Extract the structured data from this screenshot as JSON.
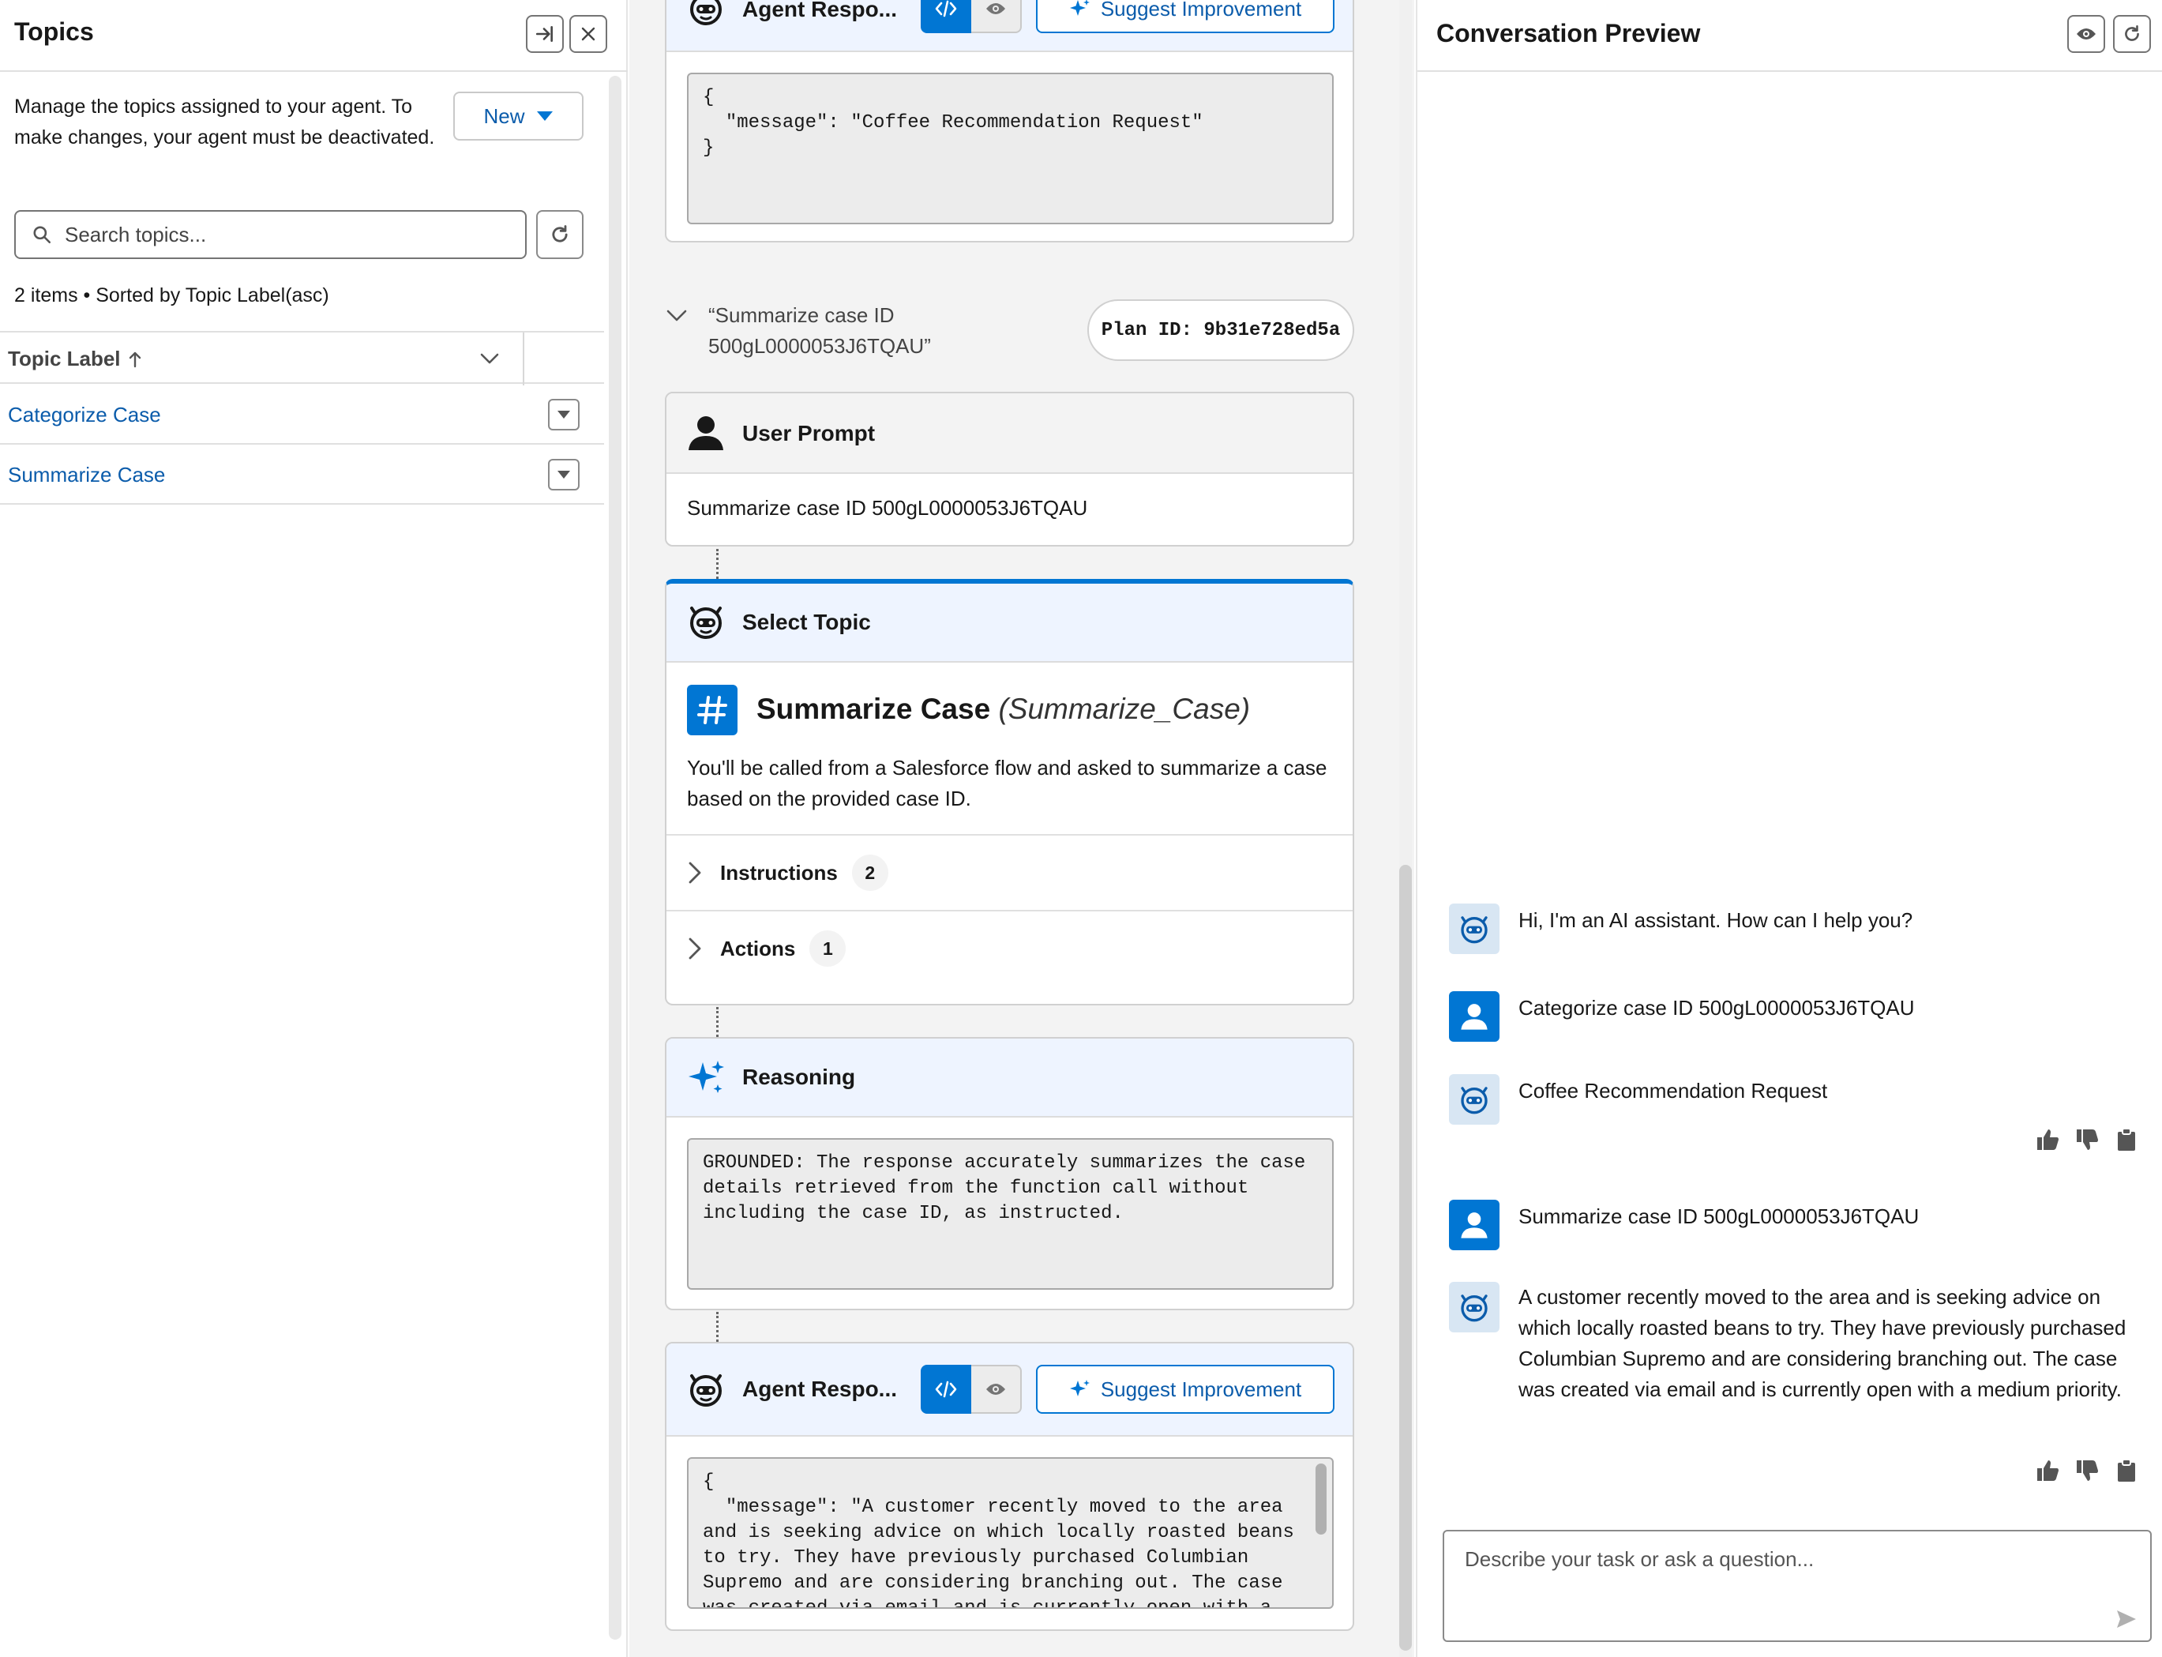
{
  "left": {
    "title": "Topics",
    "description": "Manage the topics assigned to your agent. To make changes, your agent must be deactivated.",
    "new_label": "New",
    "search_placeholder": "Search topics...",
    "items_info": "2 items • Sorted by Topic Label(asc)",
    "column_header": "Topic Label",
    "rows": [
      {
        "label": "Categorize Case"
      },
      {
        "label": "Summarize Case"
      }
    ]
  },
  "middle": {
    "top_agent_title": "Agent Respo...",
    "suggest_label": "Suggest Improvement",
    "top_response_code": "{\n  \"message\": \"Coffee Recommendation Request\"\n}",
    "plan_summary": "“Summarize case ID\n500gL0000053J6TQAU”",
    "plan_id": "Plan ID: 9b31e728ed5a",
    "user_prompt_title": "User Prompt",
    "user_prompt_text": "Summarize case ID 500gL0000053J6TQAU",
    "select_topic_title": "Select Topic",
    "topic_name": "Summarize Case",
    "topic_api": "(Summarize_Case)",
    "topic_desc": "You'll be called from a Salesforce flow and asked to summarize a case based on the provided case ID.",
    "instructions_label": "Instructions",
    "instructions_count": "2",
    "actions_label": "Actions",
    "actions_count": "1",
    "reasoning_title": "Reasoning",
    "reasoning_text": "GROUNDED: The response accurately summarizes the case details retrieved from the function call without including the case ID, as instructed.",
    "bottom_agent_title": "Agent Respo...",
    "bottom_response_code": "{\n  \"message\": \"A customer recently moved to the area and is seeking advice on which locally roasted beans to try. They have previously purchased Columbian Supremo and are considering branching out. The case was created via email and is currently open with a medium priority.\"\n}"
  },
  "right": {
    "title": "Conversation Preview",
    "messages": [
      {
        "role": "bot",
        "text": "Hi, I'm an AI assistant. How can I help you?"
      },
      {
        "role": "user",
        "text": "Categorize case ID 500gL0000053J6TQAU"
      },
      {
        "role": "bot",
        "text": "Coffee Recommendation Request"
      },
      {
        "role": "user",
        "text": "Summarize case ID 500gL0000053J6TQAU"
      },
      {
        "role": "bot",
        "text": "A customer recently moved to the area and is seeking advice on which locally roasted beans to try. They have previously purchased Columbian Supremo and are considering branching out. The case was created via email and is currently open with a medium priority."
      }
    ],
    "composer_placeholder": "Describe your task or ask a question..."
  },
  "colors": {
    "brand": "#0176d3",
    "link": "#0b5cab",
    "bot_avatar_bg": "#d8e6f3"
  },
  "icons": {
    "agent": "agent-robot-icon",
    "user": "user-person-icon",
    "topic": "hash-icon",
    "reasoning": "sparkle-icon"
  }
}
